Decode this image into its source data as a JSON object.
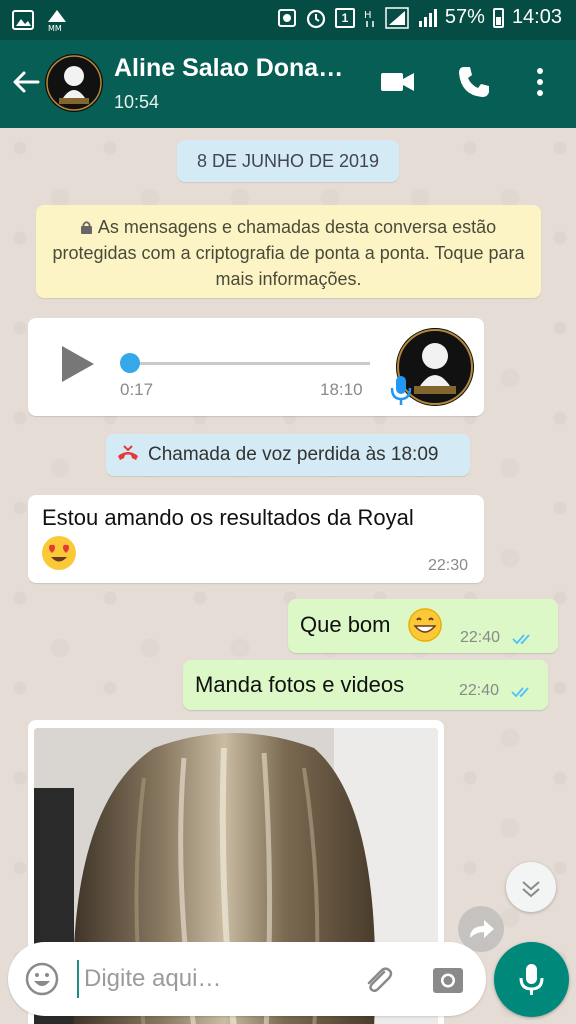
{
  "status_bar": {
    "battery": "57%",
    "time": "14:03",
    "sim_badge": "1",
    "icons": [
      "image-icon",
      "data-saver-icon",
      "recycle-icon",
      "alarm-icon",
      "sim-icon",
      "h-plus-icon",
      "signal-icon",
      "battery-icon"
    ]
  },
  "header": {
    "contact_name": "Aline Salao Dona…",
    "subtitle": "10:54",
    "icons": [
      "back-arrow-icon",
      "video-call-icon",
      "phone-icon",
      "more-vert-icon"
    ]
  },
  "chat": {
    "date_chip": "8 DE JUNHO DE 2019",
    "encryption_notice": "As mensagens e chamadas desta conversa estão protegidas com a criptografia de ponta a ponta. Toque para mais informações.",
    "audio": {
      "duration": "0:17",
      "time": "18:10",
      "progress": 0
    },
    "missed_call": "Chamada de voz perdida às 18:09",
    "messages": [
      {
        "direction": "in",
        "text": "Estou amando os resultados da Royal",
        "emoji": "heart-eyes-emoji",
        "time": "22:30"
      },
      {
        "direction": "out",
        "text": "Que bom",
        "emoji": "grinning-emoji",
        "time": "22:40",
        "status": "read"
      },
      {
        "direction": "out",
        "text": "Manda fotos  e videos",
        "time": "22:40",
        "status": "read"
      }
    ]
  },
  "composer": {
    "placeholder": "Digite aqui…"
  },
  "colors": {
    "header": "#075e54",
    "status_bar": "#054d44",
    "outgoing_bubble": "#dcf8c6",
    "mic_button": "#00897b",
    "read_ticks": "#4fc3f7"
  }
}
